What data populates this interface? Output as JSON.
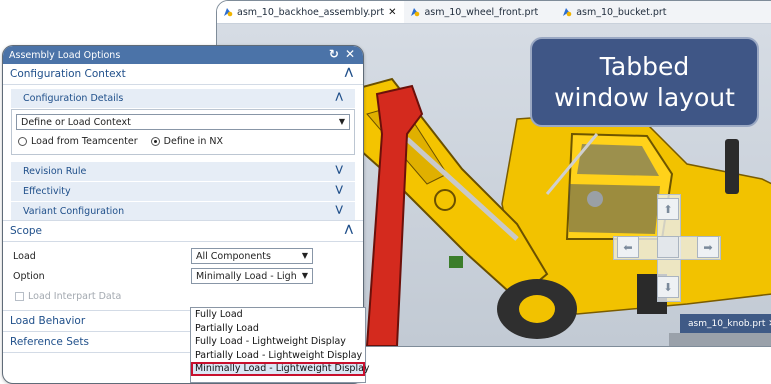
{
  "cad_window": {
    "tabs": [
      {
        "label": "asm_10_backhoe_assembly.prt",
        "close": "✕"
      },
      {
        "label": "asm_10_wheel_front.prt"
      },
      {
        "label": "asm_10_bucket.prt"
      }
    ],
    "callout_line1": "Tabbed",
    "callout_line2": "window layout",
    "knob_tab_label": "asm_10_knob.prt ✕"
  },
  "dialog": {
    "title": "Assembly Load Options",
    "reset_icon": "↻",
    "close_icon": "✕",
    "configuration_context": {
      "label": "Configuration Context",
      "details_label": "Configuration Details",
      "context_combo": "Define or Load Context",
      "radio_teamcenter": "Load from Teamcenter",
      "radio_nx": "Define in NX",
      "selected_radio": "Define in NX",
      "revision_rule": "Revision Rule",
      "effectivity": "Effectivity",
      "variant_configuration": "Variant Configuration"
    },
    "scope": {
      "label": "Scope",
      "load_label": "Load",
      "load_value": "All Components",
      "option_label": "Option",
      "option_value": "Minimally Load - Ligh",
      "interpart_label": "Load Interpart Data"
    },
    "load_behavior": "Load Behavior",
    "reference_sets": "Reference Sets"
  },
  "option_dropdown": {
    "options": [
      "Fully Load",
      "Partially Load",
      "Fully Load - Lightweight Display",
      "Partially Load - Lightweight Display",
      "Minimally Load - Lightweight Display"
    ],
    "highlighted": "Minimally Load - Lightweight Display"
  },
  "colors": {
    "accent": "#1f4f8a",
    "title_bar": "#4b73a8",
    "callout_bg": "#3f5686",
    "highlight_outline": "#c8102e",
    "machine_yellow": "#f2c200",
    "machine_red": "#d42a1e"
  }
}
